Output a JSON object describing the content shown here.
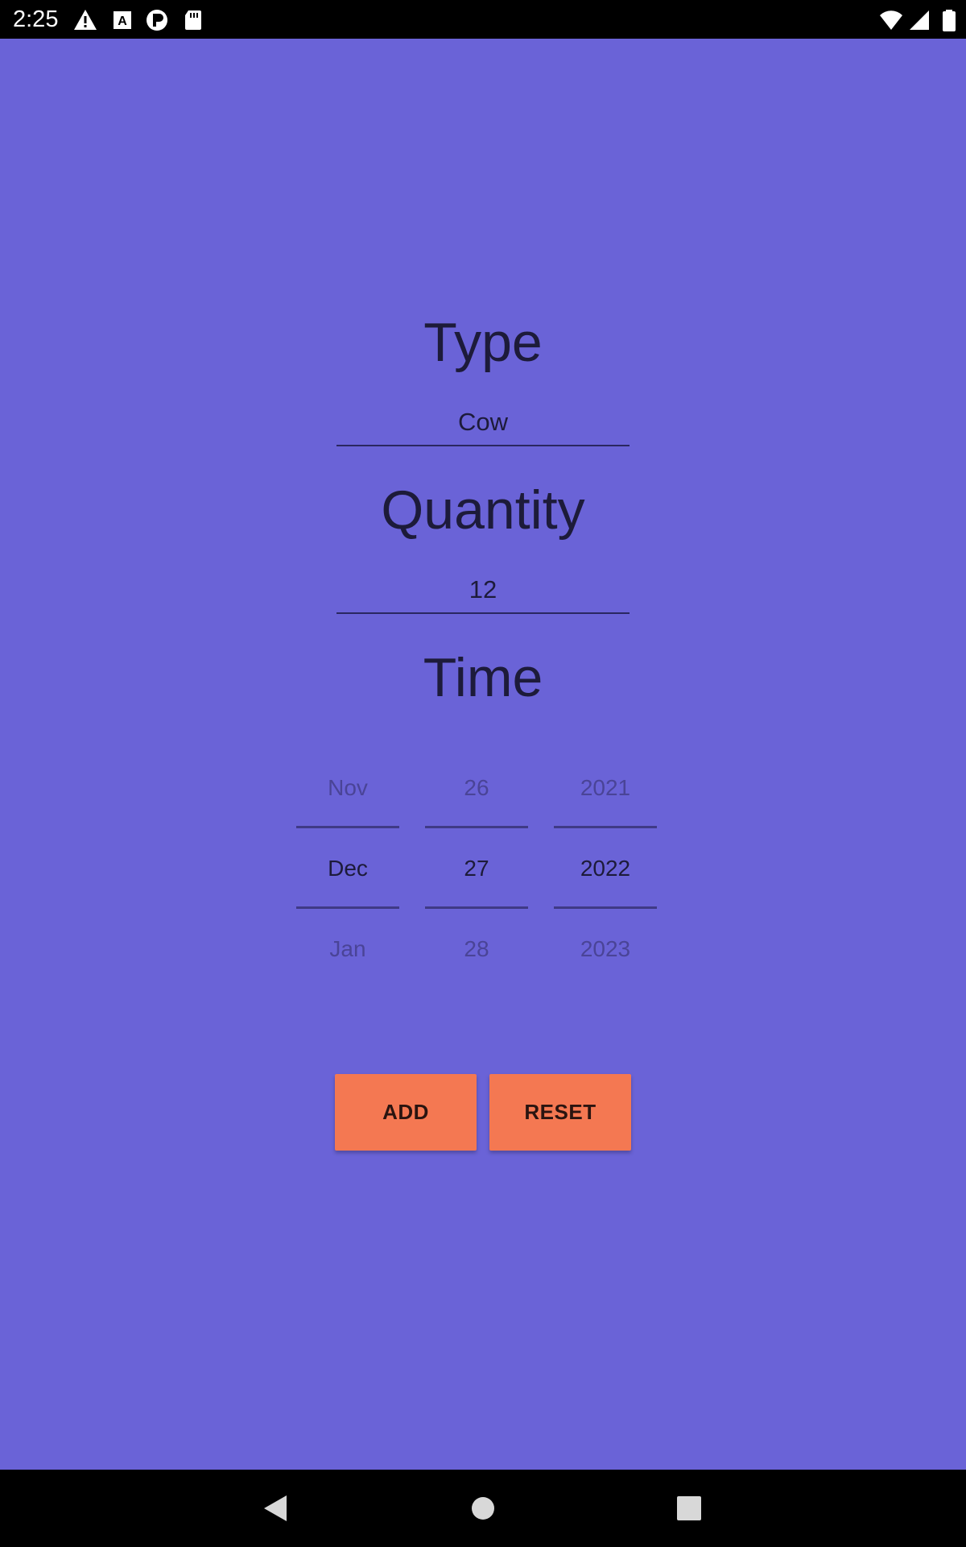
{
  "status_bar": {
    "time": "2:25",
    "icons": [
      "warning-icon",
      "font-a-icon",
      "p-badge-icon",
      "sd-card-icon",
      "wifi-icon",
      "cell-signal-icon",
      "battery-icon"
    ]
  },
  "form": {
    "type_label": "Type",
    "type_value": "Cow",
    "quantity_label": "Quantity",
    "quantity_value": "12",
    "time_label": "Time"
  },
  "date_picker": {
    "month": {
      "prev": "Nov",
      "selected": "Dec",
      "next": "Jan"
    },
    "day": {
      "prev": "26",
      "selected": "27",
      "next": "28"
    },
    "year": {
      "prev": "2021",
      "selected": "2022",
      "next": "2023"
    }
  },
  "buttons": {
    "add_label": "ADD",
    "reset_label": "RESET"
  },
  "colors": {
    "background": "#6a63d7",
    "button": "#f47852",
    "text": "#1d1b3a"
  }
}
